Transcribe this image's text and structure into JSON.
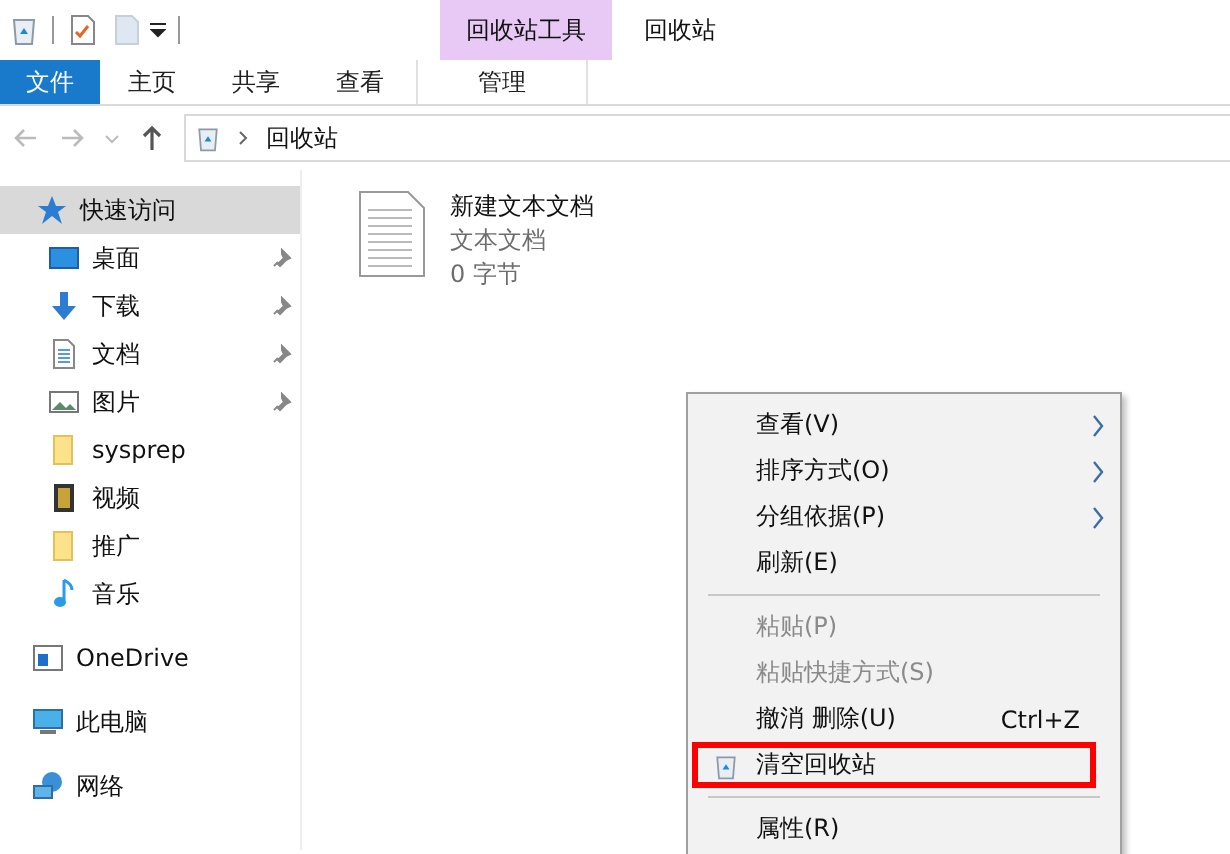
{
  "title_bar": {
    "context_tab_group": "回收站工具",
    "window_title": "回收站"
  },
  "ribbon_tabs": [
    {
      "label": "文件",
      "kind": "file",
      "selected": false
    },
    {
      "label": "主页",
      "kind": "tab",
      "selected": false
    },
    {
      "label": "共享",
      "kind": "tab",
      "selected": false
    },
    {
      "label": "查看",
      "kind": "tab",
      "selected": false
    },
    {
      "label": "管理",
      "kind": "context",
      "selected": false
    }
  ],
  "address_bar": {
    "path": "回收站"
  },
  "sidebar": {
    "items": [
      {
        "label": "快速访问",
        "selected": true,
        "pinned": false,
        "children": [
          {
            "label": "桌面",
            "selected": false,
            "pinned": true
          },
          {
            "label": "下载",
            "selected": false,
            "pinned": true
          },
          {
            "label": "文档",
            "selected": false,
            "pinned": true
          },
          {
            "label": "图片",
            "selected": false,
            "pinned": true
          },
          {
            "label": "sysprep",
            "selected": false,
            "pinned": false
          },
          {
            "label": "视频",
            "selected": false,
            "pinned": false
          },
          {
            "label": "推广",
            "selected": false,
            "pinned": false
          },
          {
            "label": "音乐",
            "selected": false,
            "pinned": false
          }
        ]
      },
      {
        "label": "OneDrive",
        "selected": false,
        "pinned": false
      },
      {
        "label": "此电脑",
        "selected": false,
        "pinned": false
      },
      {
        "label": "网络",
        "selected": false,
        "pinned": false
      }
    ]
  },
  "files": [
    {
      "name": "新建文本文档",
      "type": "文本文档",
      "size": "0 字节"
    }
  ],
  "context_menu": {
    "items": [
      {
        "kind": "item",
        "label": "查看(V)",
        "submenu": true,
        "disabled": false
      },
      {
        "kind": "item",
        "label": "排序方式(O)",
        "submenu": true,
        "disabled": false
      },
      {
        "kind": "item",
        "label": "分组依据(P)",
        "submenu": true,
        "disabled": false
      },
      {
        "kind": "item",
        "label": "刷新(E)",
        "submenu": false,
        "disabled": false
      },
      {
        "kind": "separator"
      },
      {
        "kind": "item",
        "label": "粘贴(P)",
        "submenu": false,
        "disabled": true
      },
      {
        "kind": "item",
        "label": "粘贴快捷方式(S)",
        "submenu": false,
        "disabled": true
      },
      {
        "kind": "item",
        "label": "撤消 删除(U)",
        "shortcut": "Ctrl+Z",
        "submenu": false,
        "disabled": false
      },
      {
        "kind": "item",
        "label": "清空回收站",
        "submenu": false,
        "disabled": false,
        "highlighted": true,
        "has_icon": true
      },
      {
        "kind": "separator"
      },
      {
        "kind": "item",
        "label": "属性(R)",
        "submenu": false,
        "disabled": false
      }
    ]
  }
}
